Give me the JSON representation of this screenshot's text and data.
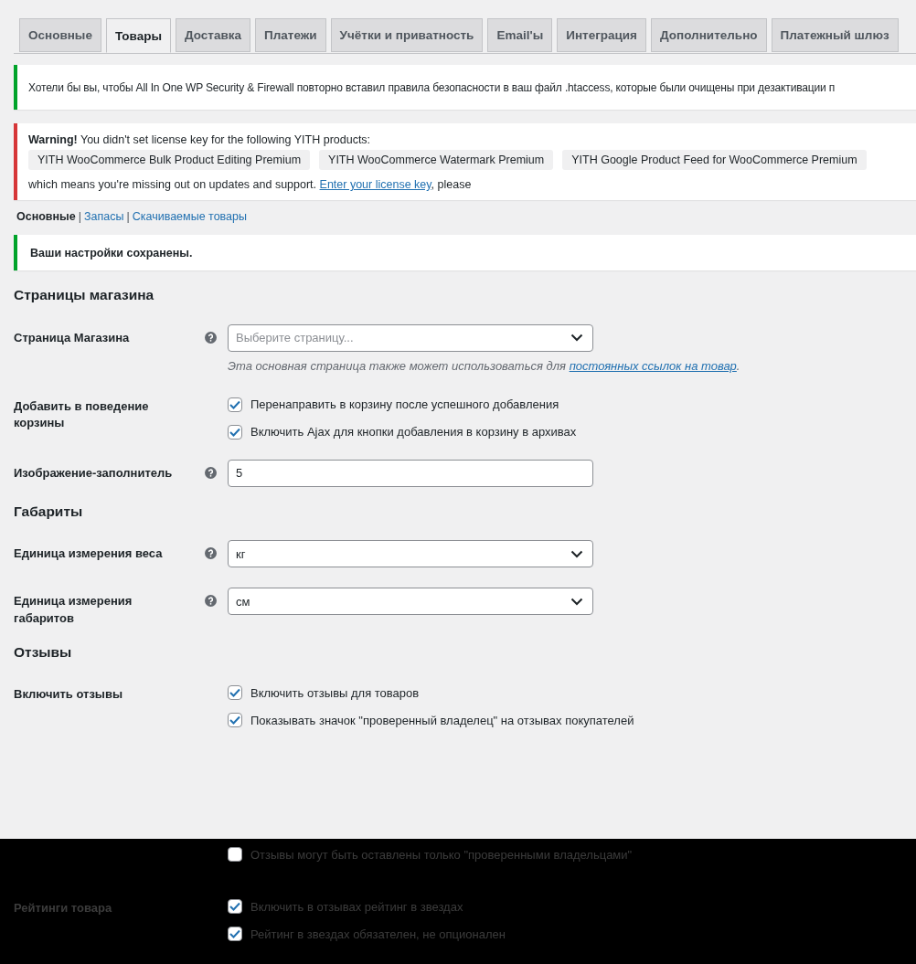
{
  "tabs": [
    {
      "label": "Основные",
      "selected": false
    },
    {
      "label": "Товары",
      "selected": true
    },
    {
      "label": "Доставка",
      "selected": false
    },
    {
      "label": "Платежи",
      "selected": false
    },
    {
      "label": "Учётки и приватность",
      "selected": false
    },
    {
      "label": "Email'ы",
      "selected": false
    },
    {
      "label": "Интеграция",
      "selected": false
    },
    {
      "label": "Дополнительно",
      "selected": false
    },
    {
      "label": "Платежный шлюз",
      "selected": false
    }
  ],
  "notices": [
    {
      "kind": "success",
      "text": "Хотели бы вы, чтобы All In One WP Security & Firewall повторно вставил правила безопасности в ваш файл .htaccess, которые были очищены при дезактивации п"
    }
  ],
  "license_warning": {
    "text": "**Warning!** You didn't set license key for the following YITH products:",
    "products": [
      "YITH WooCommerce Bulk Product Editing Premium",
      "YITH WooCommerce Watermark Premium",
      "YITH Google Product Feed for WooCommerce Premium"
    ],
    "footer_text": "which means you're missing out on updates and support.",
    "link": "Enter your license key",
    "footer_end": ", please"
  },
  "subsections": [
    {
      "label": "Основные",
      "selected": true
    },
    {
      "separator": "|",
      "label": "Запасы",
      "selected": false
    },
    {
      "separator": "|",
      "label": "Скачиваемые товары",
      "selected": false
    }
  ],
  "saved_notice": "Ваши настройки сохранены.",
  "sections": [
    {
      "title": "Страницы магазина",
      "rows": [
        {
          "label": "Страница Магазина",
          "kind": "select",
          "help": true,
          "placeholder": "Выберите страницу...",
          "description": "Эта основная страница также может использоваться для",
          "description_link": "постоянных ссылок на товар",
          "description_end": "."
        },
        {
          "label": "Добавить в поведение корзины",
          "kind": "checkboxes",
          "help": false,
          "options": [
            {
              "label": "Перенаправить в корзину после успешного добавления",
              "checked": true
            },
            {
              "label": "Включить Ajax для кнопки добавления в корзину в архивах",
              "checked": true
            }
          ]
        },
        {
          "label": "Изображение-заполнитель",
          "kind": "input",
          "help": true,
          "value": "5"
        }
      ]
    },
    {
      "title": "Габариты",
      "rows": [
        {
          "label": "Единица измерения веса",
          "kind": "select",
          "help": true,
          "value": "кг"
        },
        {
          "label": "Единица измерения габаритов",
          "kind": "select",
          "help": true,
          "value": "см"
        }
      ]
    },
    {
      "title": "Отзывы",
      "rows": [
        {
          "label": "Включить отзывы",
          "kind": "checkboxes",
          "help": false,
          "options": [
            {
              "label": "Включить отзывы для товаров",
              "checked": true
            },
            {
              "label": "Показывать значок \"проверенный владелец\" на отзывах покупателей",
              "checked": true
            }
          ]
        }
      ]
    }
  ],
  "dimmed_rows": [
    {
      "label": "",
      "options": [
        {
          "label": "Отзывы могут быть оставлены только \"проверенными владельцами\"",
          "checked": false
        }
      ]
    },
    {
      "label": "Рейтинги товара",
      "options": [
        {
          "label": "Включить в отзывах рейтинг в звездах",
          "checked": true
        },
        {
          "label": "Рейтинг в звездах обязателен, не опционален",
          "checked": true
        }
      ]
    }
  ]
}
